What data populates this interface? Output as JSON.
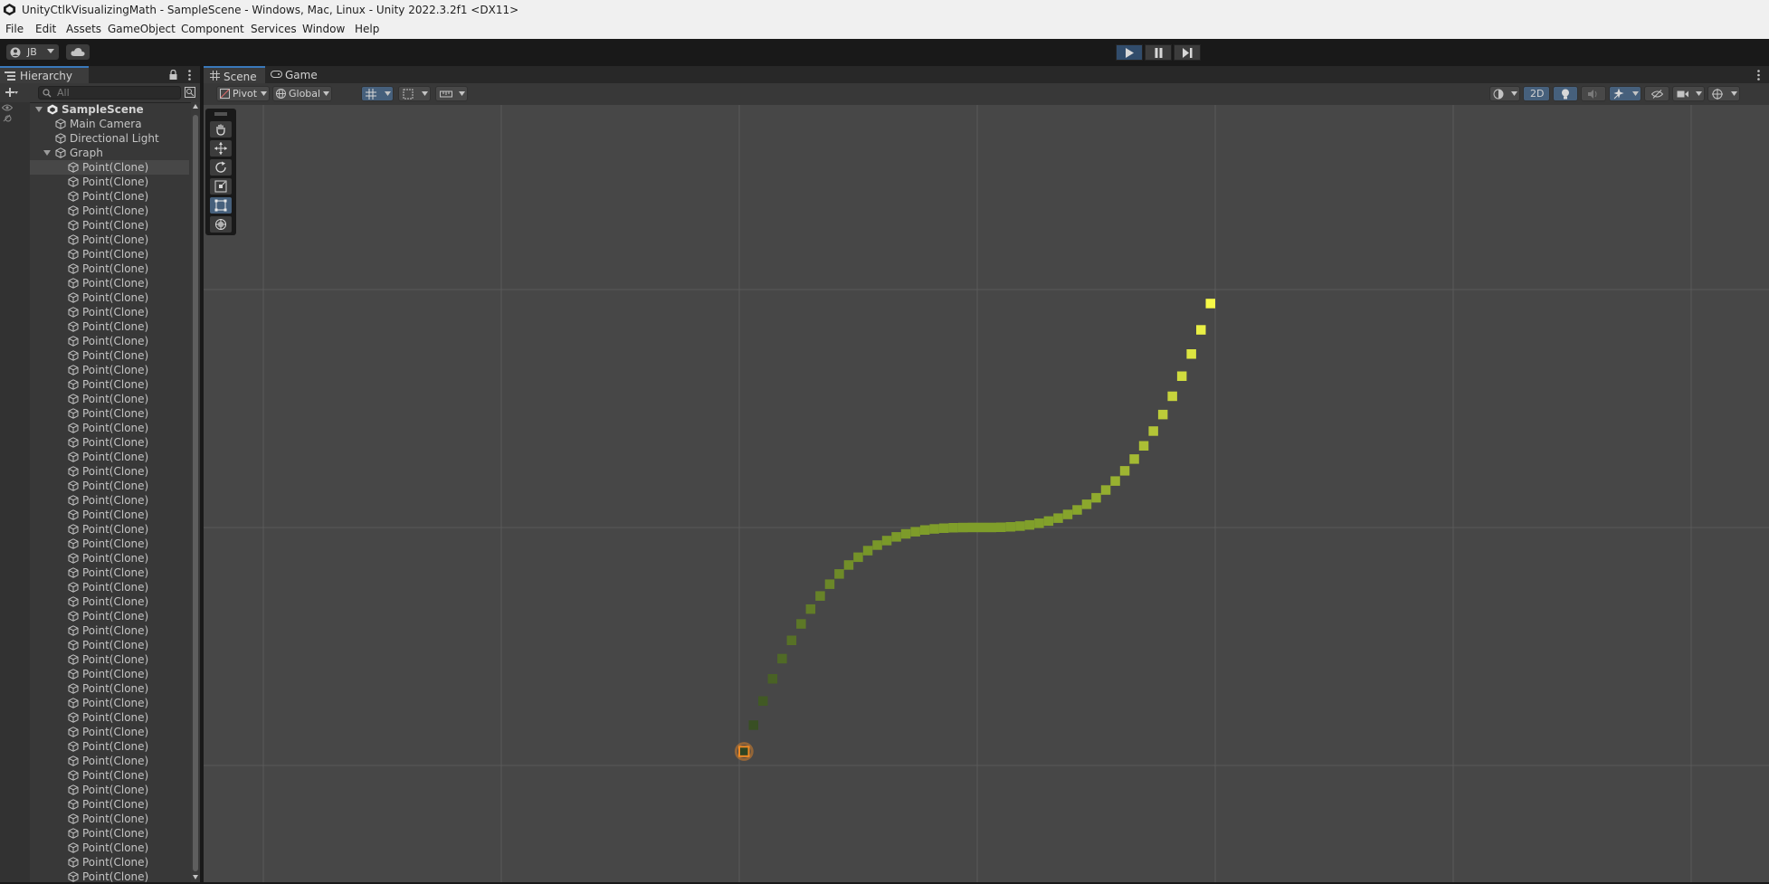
{
  "window": {
    "title": "UnityCtlkVisualizingMath - SampleScene - Windows, Mac, Linux - Unity 2022.3.2f1 <DX11>"
  },
  "menu": [
    "File",
    "Edit",
    "Assets",
    "GameObject",
    "Component",
    "Services",
    "Window",
    "Help"
  ],
  "toolbar": {
    "account_label": "JB",
    "account_icon": "user-circle-icon",
    "cloud_icon": "cloud-icon",
    "play_icon": "play-icon",
    "pause_icon": "pause-icon",
    "step_icon": "step-icon",
    "play_active": true
  },
  "hierarchy": {
    "tab_label": "Hierarchy",
    "search_placeholder": "All",
    "scene_name": "SampleScene",
    "objects": [
      "Main Camera",
      "Directional Light",
      "Graph"
    ],
    "child_label": "Point(Clone)",
    "child_rows_visible": 50,
    "selected_row": 0
  },
  "scene": {
    "tabs": [
      {
        "label": "Scene",
        "icon": "grid-icon",
        "active": true
      },
      {
        "label": "Game",
        "icon": "gamepad-icon",
        "active": false
      }
    ],
    "pivot_label": "Pivot",
    "global_label": "Global",
    "mode_2d_label": "2D",
    "tools": [
      "menu-handle-icon",
      "hand-icon",
      "move-icon",
      "rotate-icon",
      "scale-icon",
      "rect-tool-icon",
      "transform-icon"
    ],
    "active_tool": "rect-tool-icon",
    "colors": {
      "point_low": "#2a3f22",
      "point_mid": "#7f9e2a",
      "point_high": "#ffff4a",
      "selected_outline": "#f08a24",
      "grid": "#5a5a5a",
      "viewport_bg": "#474747"
    }
  }
}
